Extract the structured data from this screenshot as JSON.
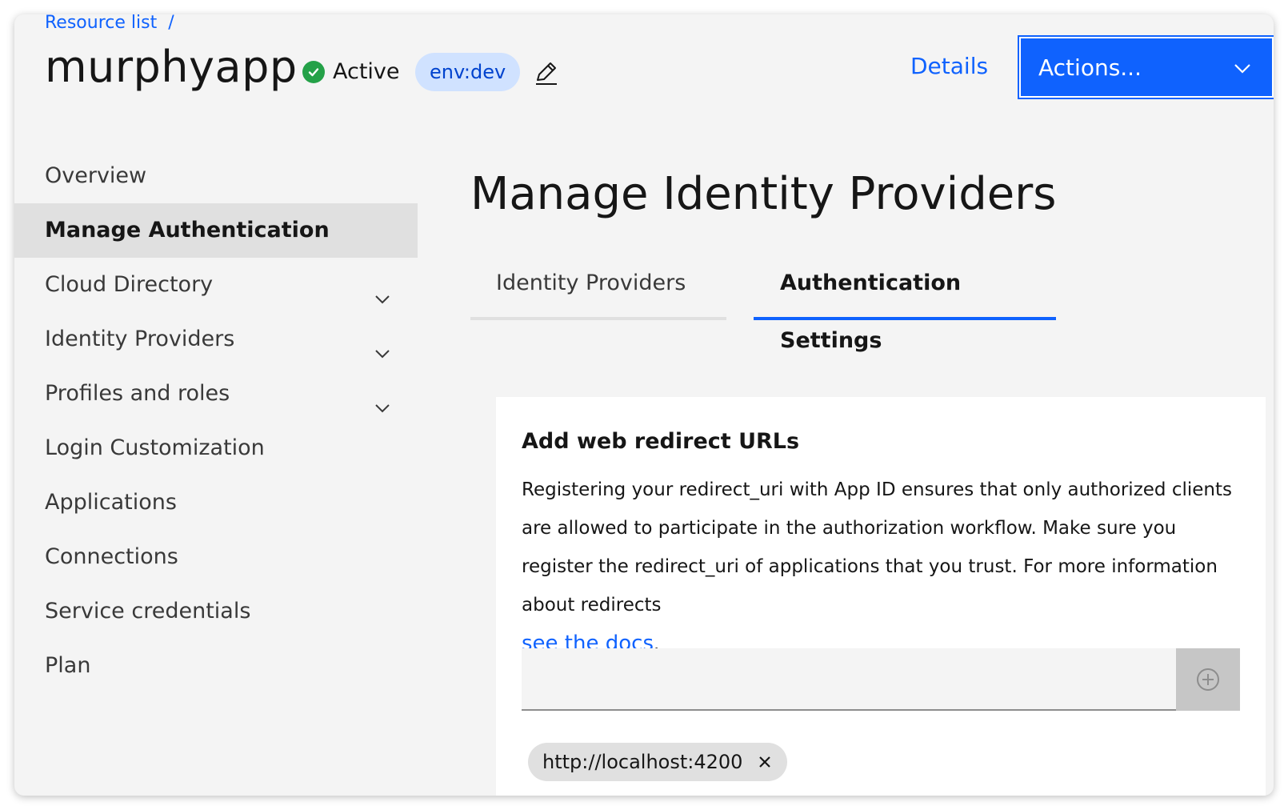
{
  "breadcrumb": {
    "label": "Resource list",
    "separator": "/"
  },
  "header": {
    "app_name": "murphyapp",
    "status": "Active",
    "env_tag": "env:dev",
    "details_link": "Details",
    "actions_button": "Actions...",
    "status_color": "#24a148",
    "accent_color": "#0f62fe"
  },
  "sidebar": {
    "items": [
      {
        "label": "Overview",
        "active": false,
        "expandable": false
      },
      {
        "label": "Manage Authentication",
        "active": true,
        "expandable": false
      },
      {
        "label": "Cloud Directory",
        "active": false,
        "expandable": true
      },
      {
        "label": "Identity Providers",
        "active": false,
        "expandable": true
      },
      {
        "label": "Profiles and roles",
        "active": false,
        "expandable": true
      },
      {
        "label": "Login Customization",
        "active": false,
        "expandable": false
      },
      {
        "label": "Applications",
        "active": false,
        "expandable": false
      },
      {
        "label": "Connections",
        "active": false,
        "expandable": false
      },
      {
        "label": "Service credentials",
        "active": false,
        "expandable": false
      },
      {
        "label": "Plan",
        "active": false,
        "expandable": false
      }
    ]
  },
  "main": {
    "title": "Manage Identity Providers",
    "tabs": [
      {
        "label": "Identity Providers",
        "selected": false
      },
      {
        "label": "Authentication Settings",
        "selected": true
      }
    ],
    "card": {
      "title": "Add web redirect URLs",
      "description": "Registering your redirect_uri with App ID ensures that only authorized clients are allowed to participate in the authorization workflow. Make sure you register the redirect_uri of applications that you trust. For more information about redirects",
      "docs_link": "see the docs",
      "docs_suffix": ".",
      "input_value": "",
      "input_placeholder": "",
      "redirect_urls": [
        "http://localhost:4200"
      ]
    }
  },
  "icons": {
    "status": "check-circle-icon",
    "edit": "pencil-icon",
    "dropdown": "chevron-down-icon",
    "add": "add-circle-icon",
    "remove": "close-icon"
  }
}
